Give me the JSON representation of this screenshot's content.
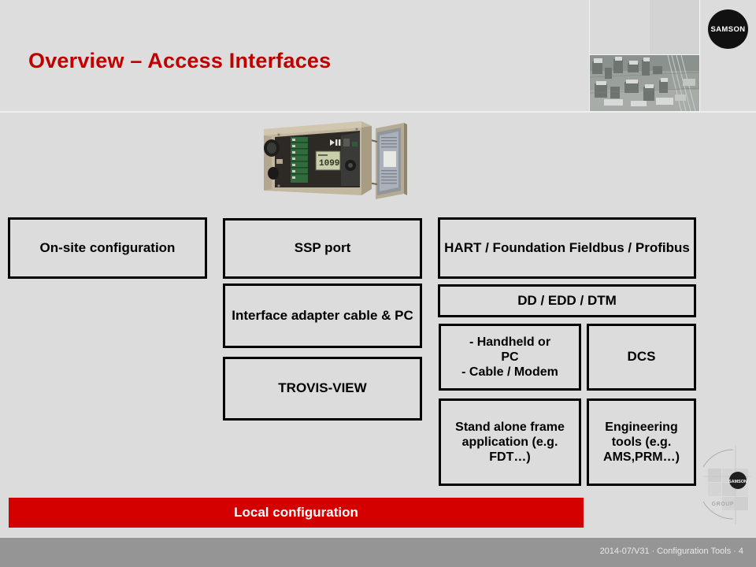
{
  "slide": {
    "title": "Overview – Access Interfaces",
    "title_color": "#c00000",
    "background_color": "#dcdcdc"
  },
  "brand": {
    "logo_text": "SAMSON",
    "watermark_text": "SAMSON",
    "watermark_subtext": "GROUP"
  },
  "diagram": {
    "columns": [
      {
        "name": "left",
        "boxes": [
          {
            "label": "On-site configuration"
          }
        ]
      },
      {
        "name": "middle",
        "boxes": [
          {
            "label": "SSP port"
          },
          {
            "label": "Interface adapter cable & PC"
          },
          {
            "label": "TROVIS-VIEW"
          }
        ]
      },
      {
        "name": "right",
        "boxes": [
          {
            "label": "HART / Foundation Fieldbus / Profibus"
          },
          {
            "label": "DD / EDD / DTM"
          },
          {
            "label": "- Handheld or PC\n- Cable / Modem"
          },
          {
            "label": "DCS"
          },
          {
            "label": "Stand alone frame application (e.g. FDT…)"
          },
          {
            "label": "Engineering tools (e.g. AMS,PRM…)"
          }
        ]
      }
    ],
    "boxes": {
      "onsite": "On-site configuration",
      "ssp_port": "SSP port",
      "interface_adapter": "Interface adapter cable & PC",
      "trovis_view": "TROVIS-VIEW",
      "hart": "HART / Foundation Fieldbus / Profibus",
      "dd_edd_dtm": "DD / EDD / DTM",
      "handheld_line1": "- Handheld or",
      "handheld_line2": "PC",
      "handheld_line3": "- Cable / Modem",
      "dcs": "DCS",
      "standalone": "Stand alone frame application (e.g. FDT…)",
      "engineering": "Engineering tools (e.g. AMS,PRM…)"
    }
  },
  "banner": {
    "label": "Local configuration",
    "color": "#d40000"
  },
  "footer": {
    "version": "2014-07/V31",
    "separator": "·",
    "section": "Configuration Tools",
    "page": "4"
  }
}
